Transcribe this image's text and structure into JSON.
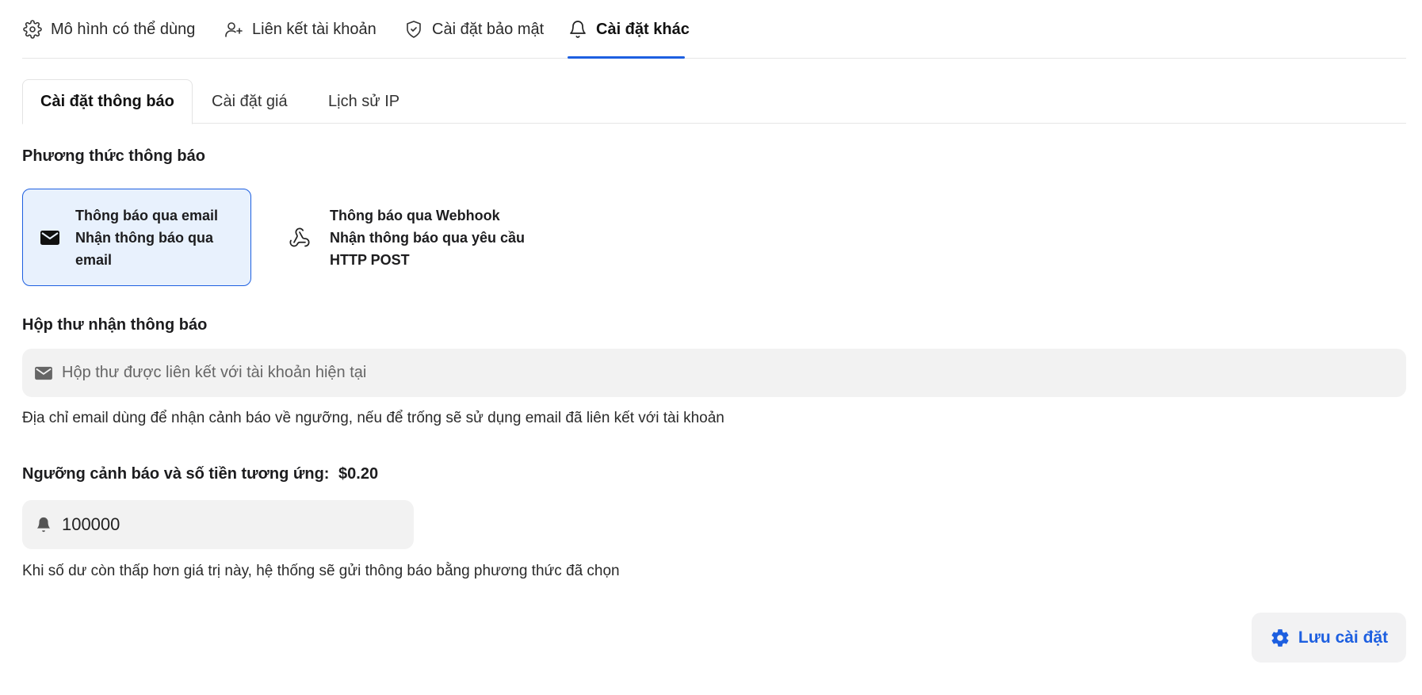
{
  "topnav": {
    "items": [
      {
        "label": "Mô hình có thể dùng",
        "icon": "gear-icon"
      },
      {
        "label": "Liên kết tài khoản",
        "icon": "user-plus-icon"
      },
      {
        "label": "Cài đặt bảo mật",
        "icon": "shield-check-icon"
      },
      {
        "label": "Cài đặt khác",
        "icon": "bell-icon",
        "active": true
      }
    ],
    "accent_color": "#1d5fe0"
  },
  "subtabs": {
    "items": [
      {
        "label": "Cài đặt thông báo",
        "active": true
      },
      {
        "label": "Cài đặt giá"
      },
      {
        "label": "Lịch sử IP"
      }
    ]
  },
  "notify_method": {
    "title": "Phương thức thông báo",
    "options": [
      {
        "icon": "mail-icon",
        "title": "Thông báo qua email",
        "line1": "Nhận thông báo qua",
        "line2": "email",
        "selected": true
      },
      {
        "icon": "webhook-icon",
        "title": "Thông báo qua Webhook",
        "line1": "Nhận thông báo qua yêu cầu",
        "line2": "HTTP POST",
        "selected": false
      }
    ]
  },
  "inbox": {
    "title": "Hộp thư nhận thông báo",
    "placeholder": "Hộp thư được liên kết với tài khoản hiện tại",
    "value": "",
    "hint": "Địa chỉ email dùng để nhận cảnh báo về ngưỡng, nếu để trống sẽ sử dụng email đã liên kết với tài khoản"
  },
  "threshold": {
    "title": "Ngưỡng cảnh báo và số tiền tương ứng:",
    "amount": "$0.20",
    "value": "100000",
    "hint": "Khi số dư còn thấp hơn giá trị này, hệ thống sẽ gửi thông báo bằng phương thức đã chọn"
  },
  "save_button": {
    "label": "Lưu cài đặt",
    "icon": "gear-icon"
  }
}
